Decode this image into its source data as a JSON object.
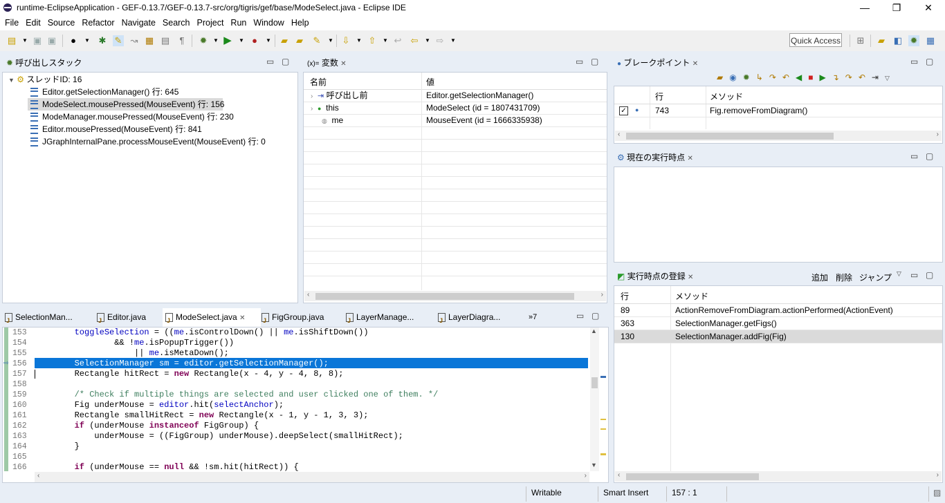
{
  "window": {
    "title": "runtime-EclipseApplication - GEF-0.13.7/GEF-0.13.7-src/org/tigris/gef/base/ModeSelect.java - Eclipse IDE",
    "min": "—",
    "restore": "❐",
    "close": "✕"
  },
  "menu": [
    "File",
    "Edit",
    "Source",
    "Refactor",
    "Navigate",
    "Search",
    "Project",
    "Run",
    "Window",
    "Help"
  ],
  "toolbar": {
    "quick_access": "Quick Access"
  },
  "callstack": {
    "tab": "呼び出しスタック",
    "thread": "スレッドID: 16",
    "frames": [
      "Editor.getSelectionManager() 行: 645",
      "ModeSelect.mousePressed(MouseEvent) 行: 156",
      "ModeManager.mousePressed(MouseEvent) 行: 230",
      "Editor.mousePressed(MouseEvent) 行: 841",
      "JGraphInternalPane.processMouseEvent(MouseEvent) 行: 0"
    ]
  },
  "variables": {
    "tab_prefix": "(x)=",
    "tab": "変数",
    "col_name": "名前",
    "col_value": "値",
    "rows": [
      {
        "name": "呼び出し前",
        "value": "Editor.getSelectionManager()"
      },
      {
        "name": "this",
        "value": "ModeSelect (id = 1807431709)"
      },
      {
        "name": "me",
        "value": "MouseEvent (id = 1666335938)"
      }
    ]
  },
  "breakpoints": {
    "tab": "ブレークポイント",
    "col_line": "行",
    "col_method": "メソッド",
    "rows": [
      {
        "line": "743",
        "method": "Fig.removeFromDiagram()",
        "checked": true
      }
    ]
  },
  "current_point": {
    "tab": "現在の実行時点"
  },
  "registry": {
    "tab": "実行時点の登録",
    "actions": [
      "追加",
      "削除",
      "ジャンプ"
    ],
    "col_line": "行",
    "col_method": "メソッド",
    "rows": [
      {
        "line": "89",
        "method": "ActionRemoveFromDiagram.actionPerformed(ActionEvent)"
      },
      {
        "line": "363",
        "method": "SelectionManager.getFigs()"
      },
      {
        "line": "130",
        "method": "SelectionManager.addFig(Fig)"
      }
    ]
  },
  "editor": {
    "tabs": [
      "SelectionMan...",
      "Editor.java",
      "ModeSelect.java",
      "FigGroup.java",
      "LayerManage...",
      "LayerDiagra..."
    ],
    "more": "»7",
    "lines": [
      {
        "n": "153",
        "text": "        toggleSelection = ((me.isControlDown() || me.isShiftDown())"
      },
      {
        "n": "154",
        "text": "                && !me.isPopupTrigger())"
      },
      {
        "n": "155",
        "text": "                    || me.isMetaDown();"
      },
      {
        "n": "156",
        "text": "        SelectionManager sm = editor.getSelectionManager();"
      },
      {
        "n": "157",
        "text": "        Rectangle hitRect = new Rectangle(x - 4, y - 4, 8, 8);"
      },
      {
        "n": "158",
        "text": ""
      },
      {
        "n": "159",
        "text": "        /* Check if multiple things are selected and user clicked one of them. */"
      },
      {
        "n": "160",
        "text": "        Fig underMouse = editor.hit(selectAnchor);"
      },
      {
        "n": "161",
        "text": "        Rectangle smallHitRect = new Rectangle(x - 1, y - 1, 3, 3);"
      },
      {
        "n": "162",
        "text": "        if (underMouse instanceof FigGroup) {"
      },
      {
        "n": "163",
        "text": "            underMouse = ((FigGroup) underMouse).deepSelect(smallHitRect);"
      },
      {
        "n": "164",
        "text": "        }"
      },
      {
        "n": "165",
        "text": ""
      },
      {
        "n": "166",
        "text": "        if (underMouse == null && !sm.hit(hitRect)) {"
      }
    ]
  },
  "status": {
    "writable": "Writable",
    "insert": "Smart Insert",
    "position": "157 : 1"
  }
}
